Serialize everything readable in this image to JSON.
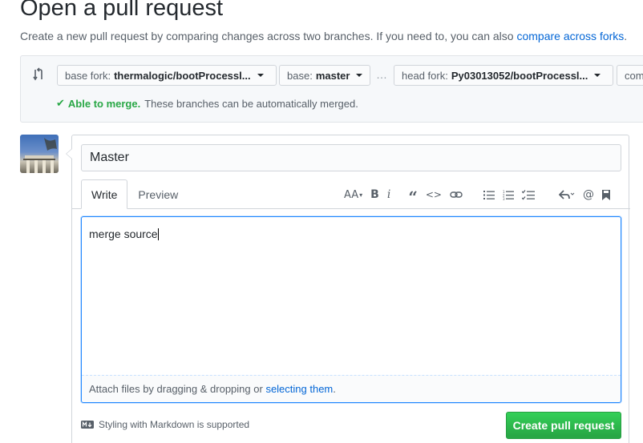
{
  "header": {
    "title": "Open a pull request",
    "subtitle": "Create a new pull request by comparing changes across two branches. If you need to, you can also",
    "compare_forks_link": "compare across forks",
    "subtitle_end": "."
  },
  "range": {
    "base_fork_label": "base fork:",
    "base_fork_value": "thermalogic/bootProcessl...",
    "base_label": "base:",
    "base_value": "master",
    "ellipsis": "…",
    "head_fork_label": "head fork:",
    "head_fork_value": "Py03013052/bootProcessl...",
    "compare_label": "com",
    "merge_ok": "Able to merge.",
    "merge_text": "These branches can be automatically merged."
  },
  "form": {
    "title_value": "Master",
    "tabs": [
      "Write",
      "Preview"
    ],
    "editor_text": "merge source",
    "attach_text": "Attach files by dragging & dropping or",
    "attach_link": "selecting them",
    "attach_end": ".",
    "markdown_note": "Styling with Markdown is supported",
    "submit_label": "Create pull request"
  },
  "toolbar": {
    "heading": "AA",
    "bold": "B",
    "italic": "i",
    "quote": "“",
    "code": "<>"
  },
  "colors": {
    "accent_green": "#28a745",
    "link_blue": "#0366d6"
  }
}
